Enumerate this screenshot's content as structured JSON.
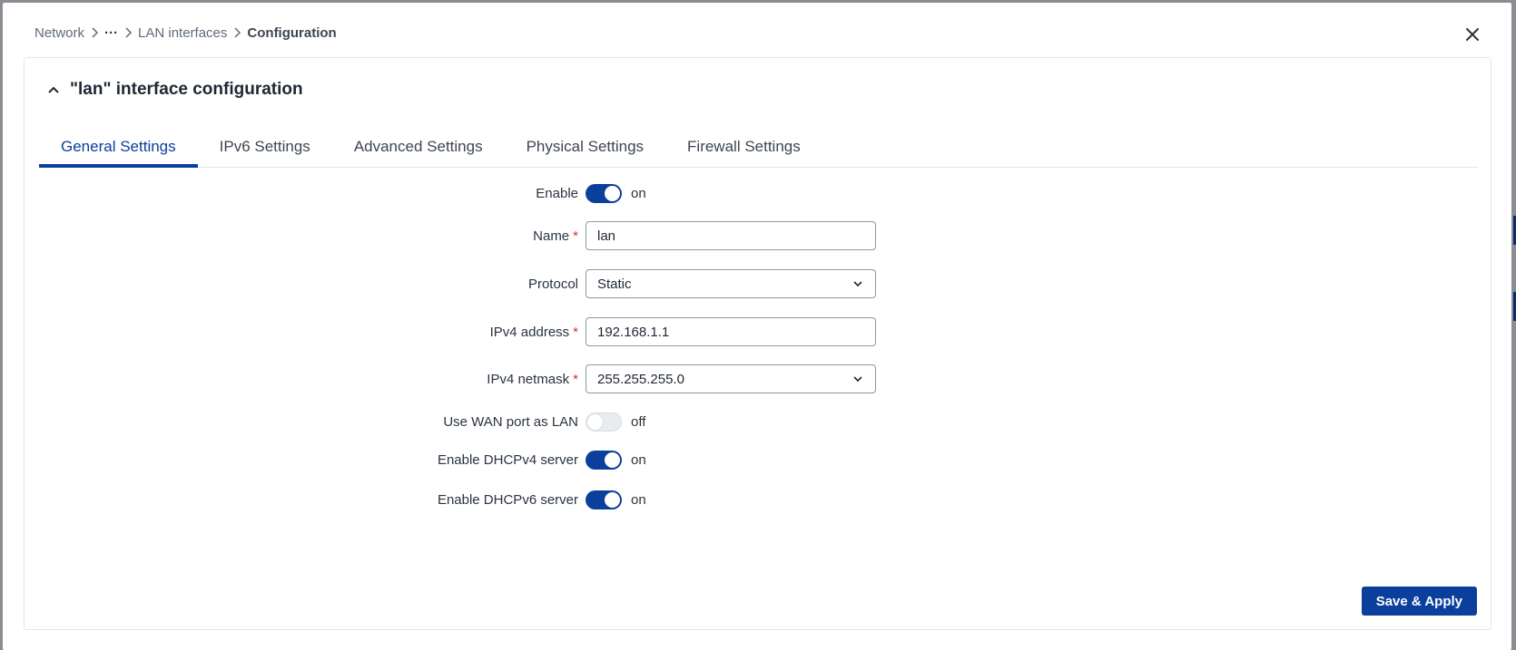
{
  "breadcrumb": {
    "items": [
      "Network",
      "LAN interfaces",
      "Configuration"
    ],
    "ellipsis": "···"
  },
  "card": {
    "title": "\"lan\" interface configuration"
  },
  "tabs": [
    {
      "label": "General Settings",
      "active": true
    },
    {
      "label": "IPv6 Settings",
      "active": false
    },
    {
      "label": "Advanced Settings",
      "active": false
    },
    {
      "label": "Physical Settings",
      "active": false
    },
    {
      "label": "Firewall Settings",
      "active": false
    }
  ],
  "form": {
    "enable": {
      "label": "Enable",
      "state": "on"
    },
    "name": {
      "label": "Name",
      "required": "*",
      "value": "lan"
    },
    "protocol": {
      "label": "Protocol",
      "value": "Static"
    },
    "ipv4_address": {
      "label": "IPv4 address",
      "required": "*",
      "value": "192.168.1.1"
    },
    "ipv4_netmask": {
      "label": "IPv4 netmask",
      "required": "*",
      "value": "255.255.255.0"
    },
    "use_wan_as_lan": {
      "label": "Use WAN port as LAN",
      "state": "off"
    },
    "dhcpv4": {
      "label": "Enable DHCPv4 server",
      "state": "on"
    },
    "dhcpv6": {
      "label": "Enable DHCPv6 server",
      "state": "on"
    }
  },
  "actions": {
    "save_label": "Save & Apply"
  },
  "colors": {
    "accent": "#0b3f9c",
    "required": "#d0342c"
  },
  "icons": {
    "close": "close-icon",
    "collapse": "chevron-up-icon",
    "dropdown": "chevron-down-icon",
    "separator": "chevron-right-icon"
  }
}
